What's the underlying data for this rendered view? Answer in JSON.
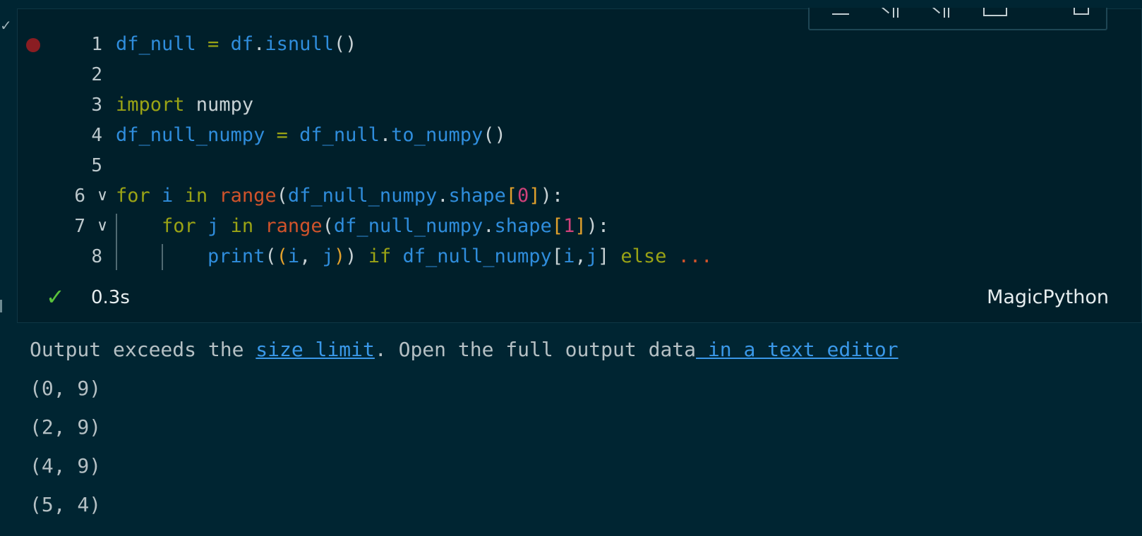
{
  "editor": {
    "lines": [
      {
        "number": "1",
        "breakpoint": true,
        "fold": false,
        "tokens": [
          {
            "t": "df_null",
            "c": "var"
          },
          {
            "t": " = ",
            "c": "kw"
          },
          {
            "t": "df",
            "c": "var"
          },
          {
            "t": ".",
            "c": "def"
          },
          {
            "t": "isnull",
            "c": "meth"
          },
          {
            "t": "()",
            "c": "def"
          }
        ]
      },
      {
        "number": "2",
        "breakpoint": false,
        "fold": false,
        "tokens": []
      },
      {
        "number": "3",
        "breakpoint": false,
        "fold": false,
        "tokens": [
          {
            "t": "import",
            "c": "kw"
          },
          {
            "t": " numpy",
            "c": "def"
          }
        ]
      },
      {
        "number": "4",
        "breakpoint": false,
        "fold": false,
        "tokens": [
          {
            "t": "df_null_numpy",
            "c": "var"
          },
          {
            "t": " = ",
            "c": "kw"
          },
          {
            "t": "df_null",
            "c": "var"
          },
          {
            "t": ".",
            "c": "def"
          },
          {
            "t": "to_numpy",
            "c": "meth"
          },
          {
            "t": "()",
            "c": "def"
          }
        ]
      },
      {
        "number": "5",
        "breakpoint": false,
        "fold": false,
        "tokens": []
      },
      {
        "number": "6",
        "breakpoint": false,
        "fold": true,
        "tokens": [
          {
            "t": "for",
            "c": "kw"
          },
          {
            "t": " ",
            "c": "def"
          },
          {
            "t": "i",
            "c": "var"
          },
          {
            "t": " in ",
            "c": "kw"
          },
          {
            "t": "range",
            "c": "fn"
          },
          {
            "t": "(",
            "c": "def"
          },
          {
            "t": "df_null_numpy",
            "c": "var"
          },
          {
            "t": ".",
            "c": "def"
          },
          {
            "t": "shape",
            "c": "var"
          },
          {
            "t": "[",
            "c": "br1"
          },
          {
            "t": "0",
            "c": "num"
          },
          {
            "t": "]",
            "c": "br1"
          },
          {
            "t": "):",
            "c": "def"
          }
        ]
      },
      {
        "number": "7",
        "breakpoint": false,
        "fold": true,
        "tokens": [
          {
            "t": "    ",
            "c": "def"
          },
          {
            "t": "for",
            "c": "kw"
          },
          {
            "t": " ",
            "c": "def"
          },
          {
            "t": "j",
            "c": "var"
          },
          {
            "t": " in ",
            "c": "kw"
          },
          {
            "t": "range",
            "c": "fn"
          },
          {
            "t": "(",
            "c": "def"
          },
          {
            "t": "df_null_numpy",
            "c": "var"
          },
          {
            "t": ".",
            "c": "def"
          },
          {
            "t": "shape",
            "c": "var"
          },
          {
            "t": "[",
            "c": "br1"
          },
          {
            "t": "1",
            "c": "num"
          },
          {
            "t": "]",
            "c": "br1"
          },
          {
            "t": "):",
            "c": "def"
          }
        ]
      },
      {
        "number": "8",
        "breakpoint": false,
        "fold": false,
        "tokens": [
          {
            "t": "        ",
            "c": "def"
          },
          {
            "t": "print",
            "c": "meth"
          },
          {
            "t": "(",
            "c": "def"
          },
          {
            "t": "(",
            "c": "br1"
          },
          {
            "t": "i",
            "c": "var"
          },
          {
            "t": ", ",
            "c": "def"
          },
          {
            "t": "j",
            "c": "var"
          },
          {
            "t": ")",
            "c": "br1"
          },
          {
            "t": ")",
            "c": "def"
          },
          {
            "t": " if ",
            "c": "kw"
          },
          {
            "t": "df_null_numpy",
            "c": "var"
          },
          {
            "t": "[",
            "c": "def"
          },
          {
            "t": "i",
            "c": "var"
          },
          {
            "t": ",",
            "c": "def"
          },
          {
            "t": "j",
            "c": "var"
          },
          {
            "t": "]",
            "c": "def"
          },
          {
            "t": " else ",
            "c": "kw"
          },
          {
            "t": "...",
            "c": "fn"
          }
        ]
      }
    ]
  },
  "status": {
    "check_icon": "check-icon",
    "time": "0.3s",
    "language": "MagicPython"
  },
  "toolbar": {
    "icons": [
      "collapse-icon",
      "run-above-icon",
      "run-below-icon",
      "split-cell-icon",
      "delete-icon"
    ]
  },
  "output": {
    "message_prefix": "Output exceeds the ",
    "size_limit_link": "size limit",
    "message_middle": ". Open the full output data",
    "editor_link": " in a text editor",
    "rows": [
      "(0, 9)",
      "(2, 9)",
      "(4, 9)",
      "(5, 4)"
    ]
  },
  "colors": {
    "background": "#002532",
    "cell_background": "#001f2a",
    "success": "#59c33b",
    "link": "#3a98e8",
    "breakpoint": "#8a1d22"
  }
}
